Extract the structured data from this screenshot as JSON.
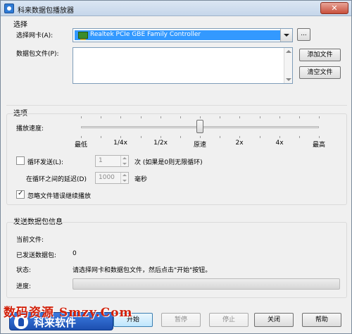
{
  "window": {
    "title": "科来数据包播放器",
    "close_glyph": "✕"
  },
  "select_group": {
    "title": "选择",
    "adapter_label": "选择网卡(A):",
    "adapter_value": "Realtek PCIe GBE Family Controller",
    "browse_label": "...",
    "packet_file_label": "数据包文件(P):",
    "add_file_label": "添加文件",
    "clear_file_label": "清空文件"
  },
  "options_group": {
    "title": "选项",
    "speed_label": "播放速度:",
    "speed_ticks": [
      "最低",
      "1/4x",
      "1/2x",
      "原速",
      "2x",
      "4x",
      "最高"
    ],
    "speed_selected": "原速",
    "loop_label": "循环发送(L):",
    "loop_checked": false,
    "loop_value": "1",
    "loop_hint": "次 (如果是0则无限循环)",
    "delay_label": "在循环之间的延迟(D)",
    "delay_value": "1000",
    "delay_unit": "毫秒",
    "ignore_errors_label": "忽略文件错误继续播放",
    "ignore_errors_checked": true
  },
  "info_group": {
    "title": "发送数据包信息",
    "current_file_label": "当前文件:",
    "current_file_value": "",
    "sent_label": "已发送数据包:",
    "sent_value": "0",
    "status_label": "状态:",
    "status_value": "请选择网卡和数据包文件，然后点击\"开始\"按钮。",
    "progress_label": "进度:",
    "progress_value": 0
  },
  "footer": {
    "start_label": "开始",
    "pause_label": "暂停",
    "stop_label": "停止",
    "close_label": "关闭",
    "help_label": "帮助"
  },
  "watermark": {
    "text": "数码资源 Smzy.Com",
    "badge_text": "科来软件"
  },
  "colors": {
    "selection": "#3399ff",
    "watermark_red": "#d2210a",
    "badge_blue": "#1d4fb0"
  }
}
